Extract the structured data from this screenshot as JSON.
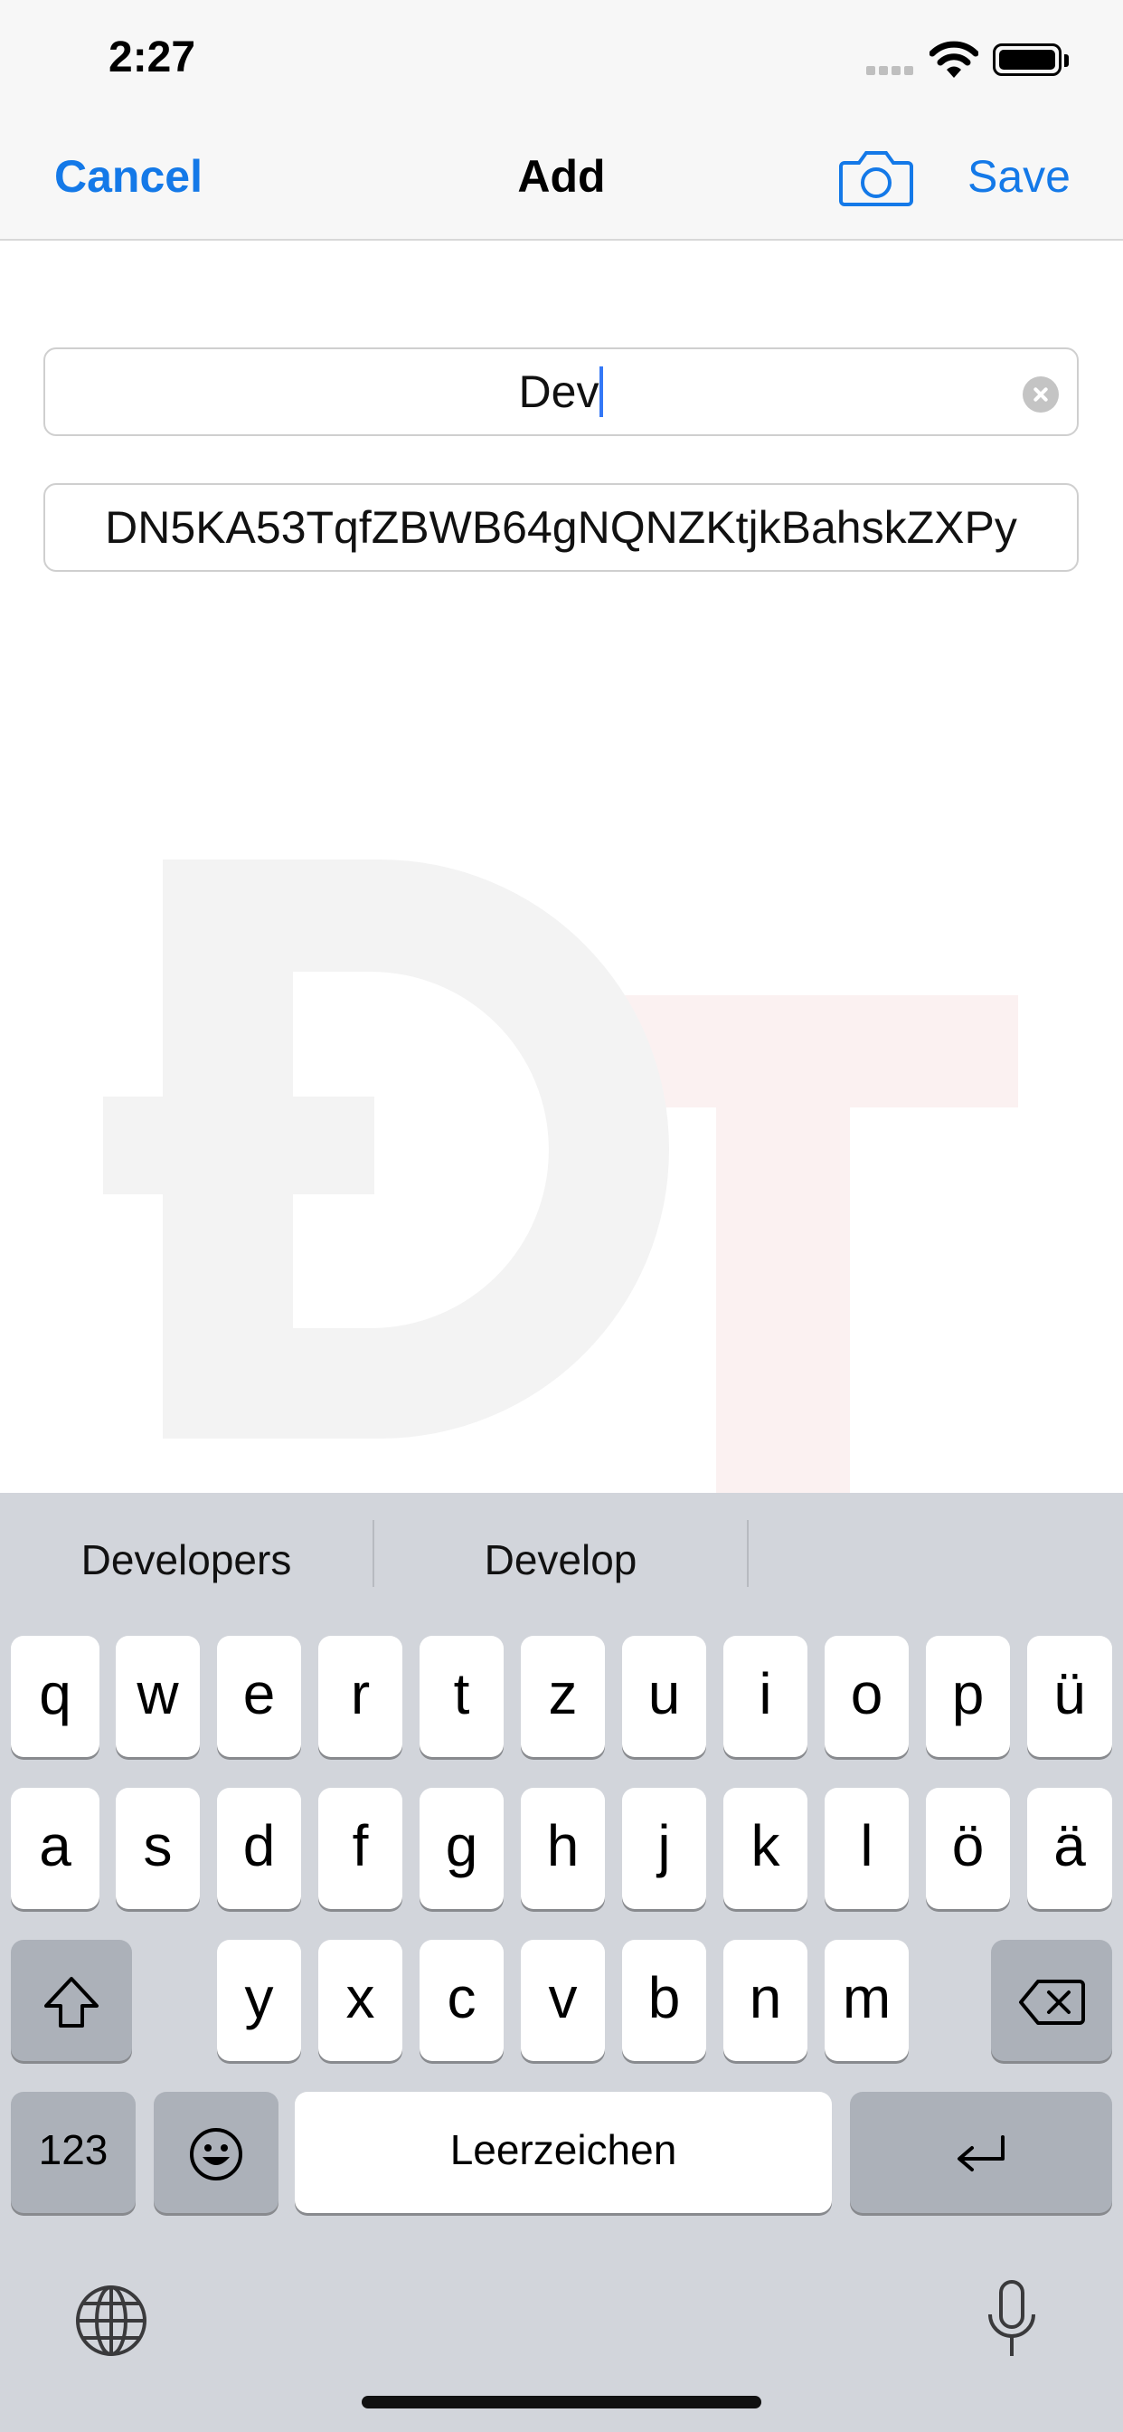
{
  "status_bar": {
    "time": "2:27"
  },
  "nav": {
    "cancel_label": "Cancel",
    "title": "Add",
    "save_label": "Save",
    "camera_icon": "camera-icon"
  },
  "form": {
    "name_value": "Dev",
    "address_value": "DN5KA53TqfZBWB64gNQNZKtjkBahskZXPy"
  },
  "watermark": {
    "letters": "ĐT"
  },
  "colors": {
    "accent": "#1479e8",
    "caret": "#3478f6",
    "keyboard_bg": "#d2d5db"
  },
  "keyboard": {
    "suggestions": [
      "Developers",
      "Develop",
      ""
    ],
    "row1": [
      "q",
      "w",
      "e",
      "r",
      "t",
      "z",
      "u",
      "i",
      "o",
      "p",
      "ü"
    ],
    "row2": [
      "a",
      "s",
      "d",
      "f",
      "g",
      "h",
      "j",
      "k",
      "l",
      "ö",
      "ä"
    ],
    "row3": [
      "y",
      "x",
      "c",
      "v",
      "b",
      "n",
      "m"
    ],
    "numbers_label": "123",
    "space_label": "Leerzeichen"
  }
}
